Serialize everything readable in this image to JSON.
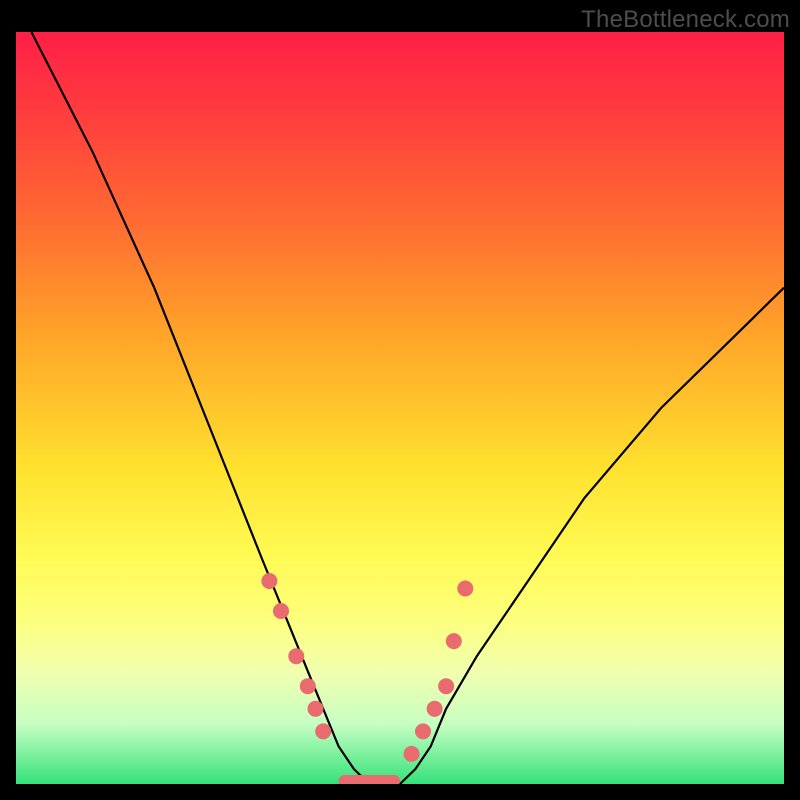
{
  "watermark": "TheBottleneck.com",
  "colors": {
    "background_frame": "#000000",
    "gradient_top": "#ff1f47",
    "gradient_bottom": "#34e27b",
    "curve_stroke": "#000000",
    "marker_fill": "#e96a6f",
    "watermark_text": "#4d4d4d"
  },
  "chart_data": {
    "type": "line",
    "title": "",
    "xlabel": "",
    "ylabel": "",
    "xlim": [
      0,
      100
    ],
    "ylim": [
      0,
      100
    ],
    "grid": false,
    "legend": false,
    "series": [
      {
        "name": "bottleneck-curve",
        "x": [
          2,
          10,
          18,
          25,
          32,
          36,
          38,
          40,
          42,
          44,
          46,
          48,
          50,
          52,
          54,
          56,
          60,
          66,
          74,
          84,
          96,
          100
        ],
        "y": [
          100,
          84,
          66,
          48,
          30,
          20,
          15,
          10,
          5,
          2,
          0,
          0,
          0,
          2,
          5,
          10,
          17,
          26,
          38,
          50,
          62,
          66
        ]
      }
    ],
    "annotations": {
      "left_markers_x": [
        33,
        34.5,
        36.5,
        38,
        39,
        40
      ],
      "left_markers_y": [
        27,
        23,
        17,
        13,
        10,
        7
      ],
      "right_markers_x": [
        51.5,
        53,
        54.5,
        56,
        57,
        58.5
      ],
      "right_markers_y": [
        4,
        7,
        10,
        13,
        19,
        26
      ],
      "flat_bottom_x_range": [
        42,
        50
      ],
      "flat_bottom_y": 0
    },
    "background_gradient": {
      "axis": "y",
      "stops": [
        {
          "pos": 0.0,
          "color": "#34e27b"
        },
        {
          "pos": 0.08,
          "color": "#c7ffc2"
        },
        {
          "pos": 0.15,
          "color": "#f1ffae"
        },
        {
          "pos": 0.22,
          "color": "#fdff7c"
        },
        {
          "pos": 0.3,
          "color": "#fffb55"
        },
        {
          "pos": 0.42,
          "color": "#ffe12e"
        },
        {
          "pos": 0.6,
          "color": "#ffa329"
        },
        {
          "pos": 0.75,
          "color": "#ff6a32"
        },
        {
          "pos": 0.9,
          "color": "#ff3a3f"
        },
        {
          "pos": 1.0,
          "color": "#ff1f47"
        }
      ]
    }
  }
}
